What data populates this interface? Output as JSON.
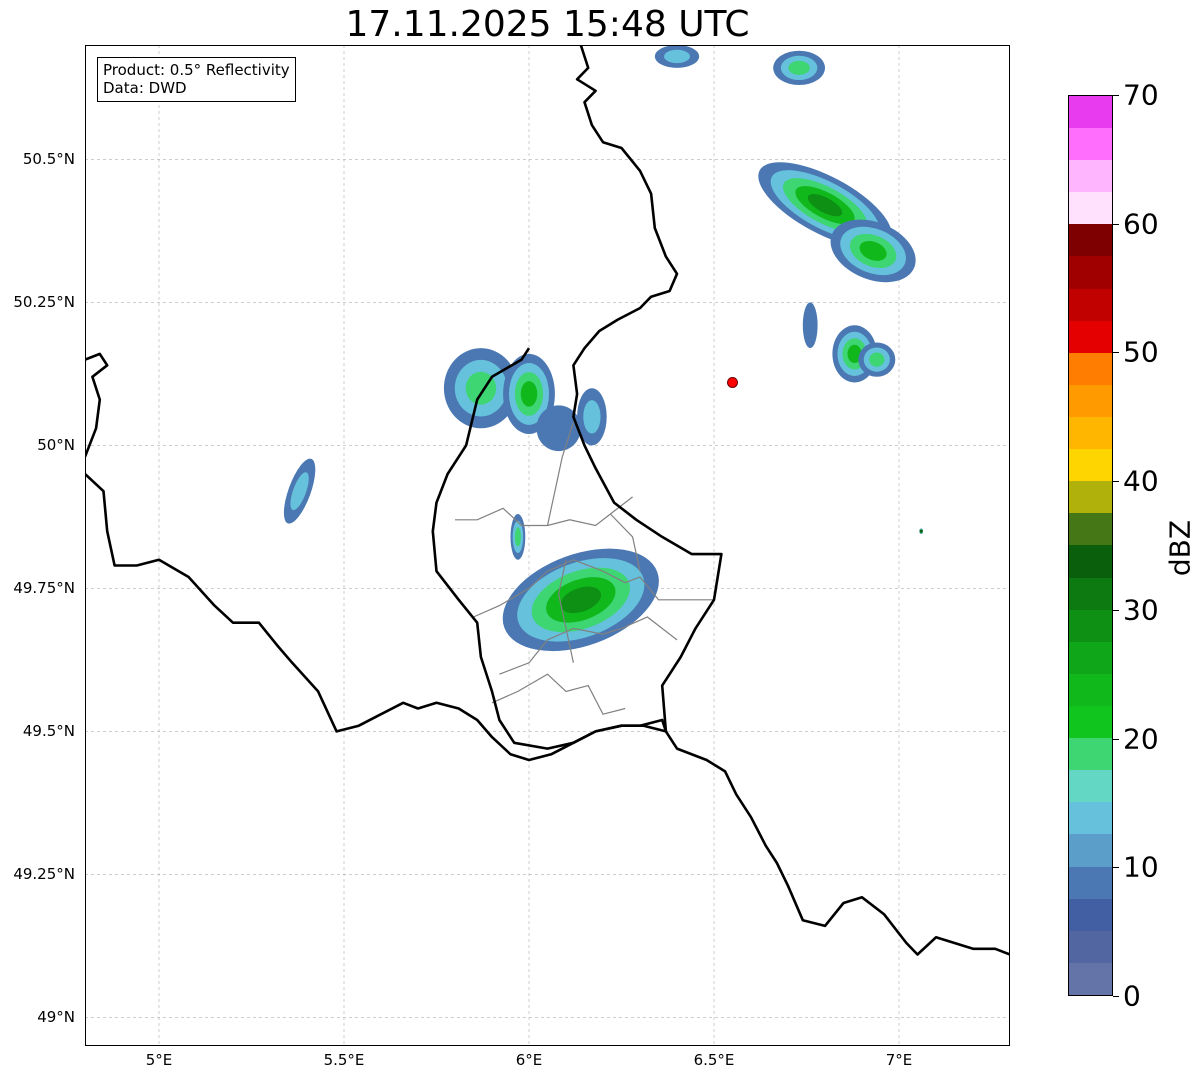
{
  "title": "17.11.2025 15:48 UTC",
  "info": {
    "product": "Product: 0.5° Reflectivity",
    "data": "Data: DWD"
  },
  "map": {
    "lon_range": [
      4.8,
      7.3
    ],
    "lat_range": [
      48.95,
      50.7
    ],
    "grid": true,
    "lon_ticks": [
      {
        "value": 5.0,
        "label": "5°E"
      },
      {
        "value": 5.5,
        "label": "5.5°E"
      },
      {
        "value": 6.0,
        "label": "6°E"
      },
      {
        "value": 6.5,
        "label": "6.5°E"
      },
      {
        "value": 7.0,
        "label": "7°E"
      }
    ],
    "lat_ticks": [
      {
        "value": 50.5,
        "label": "50.5°N"
      },
      {
        "value": 50.25,
        "label": "50.25°N"
      },
      {
        "value": 50.0,
        "label": "50°N"
      },
      {
        "value": 49.75,
        "label": "49.75°N"
      },
      {
        "value": 49.5,
        "label": "49.5°N"
      },
      {
        "value": 49.25,
        "label": "49.25°N"
      },
      {
        "value": 49.0,
        "label": "49°N"
      }
    ],
    "radar_site": {
      "lon": 6.55,
      "lat": 50.11,
      "color": "#ff0000"
    },
    "country_borders": [
      [
        [
          6.14,
          50.7
        ],
        [
          6.16,
          50.66
        ],
        [
          6.13,
          50.64
        ],
        [
          6.18,
          50.62
        ],
        [
          6.15,
          50.6
        ],
        [
          6.17,
          50.56
        ],
        [
          6.2,
          50.53
        ],
        [
          6.25,
          50.52
        ],
        [
          6.3,
          50.48
        ],
        [
          6.33,
          50.44
        ],
        [
          6.34,
          50.38
        ],
        [
          6.37,
          50.33
        ],
        [
          6.4,
          50.3
        ],
        [
          6.38,
          50.27
        ],
        [
          6.33,
          50.26
        ],
        [
          6.3,
          50.24
        ],
        [
          6.24,
          50.22
        ],
        [
          6.19,
          50.2
        ],
        [
          6.15,
          50.17
        ],
        [
          6.12,
          50.14
        ],
        [
          6.13,
          50.09
        ],
        [
          6.12,
          50.05
        ],
        [
          6.15,
          50.0
        ],
        [
          6.18,
          49.96
        ],
        [
          6.23,
          49.9
        ],
        [
          6.29,
          49.87
        ],
        [
          6.36,
          49.84
        ],
        [
          6.44,
          49.81
        ],
        [
          6.52,
          49.81
        ],
        [
          6.51,
          49.77
        ],
        [
          6.5,
          49.73
        ],
        [
          6.45,
          49.68
        ],
        [
          6.41,
          49.63
        ],
        [
          6.36,
          49.58
        ],
        [
          6.37,
          49.5
        ]
      ],
      [
        [
          6.37,
          49.5
        ],
        [
          6.36,
          49.52
        ],
        [
          6.3,
          49.51
        ],
        [
          6.25,
          49.51
        ],
        [
          6.18,
          49.5
        ],
        [
          6.12,
          49.48
        ],
        [
          6.06,
          49.46
        ],
        [
          6.0,
          49.45
        ],
        [
          5.95,
          49.46
        ],
        [
          5.9,
          49.49
        ],
        [
          5.86,
          49.52
        ],
        [
          5.81,
          49.54
        ],
        [
          5.75,
          49.55
        ],
        [
          5.7,
          49.54
        ],
        [
          5.66,
          49.55
        ],
        [
          5.6,
          49.53
        ],
        [
          5.54,
          49.51
        ],
        [
          5.48,
          49.5
        ],
        [
          5.43,
          49.57
        ],
        [
          5.36,
          49.62
        ],
        [
          5.32,
          49.65
        ],
        [
          5.27,
          49.69
        ],
        [
          5.2,
          49.69
        ],
        [
          5.15,
          49.72
        ],
        [
          5.08,
          49.77
        ],
        [
          5.0,
          49.8
        ],
        [
          4.94,
          49.79
        ],
        [
          4.88,
          49.79
        ],
        [
          4.86,
          49.85
        ],
        [
          4.85,
          49.92
        ],
        [
          4.8,
          49.95
        ]
      ],
      [
        [
          4.8,
          49.98
        ],
        [
          4.83,
          50.03
        ],
        [
          4.84,
          50.08
        ],
        [
          4.82,
          50.12
        ],
        [
          4.86,
          50.14
        ],
        [
          4.84,
          50.16
        ],
        [
          4.8,
          50.15
        ]
      ],
      [
        [
          6.37,
          49.5
        ],
        [
          6.4,
          49.47
        ],
        [
          6.48,
          49.45
        ],
        [
          6.53,
          49.43
        ],
        [
          6.56,
          49.39
        ],
        [
          6.6,
          49.35
        ],
        [
          6.64,
          49.3
        ],
        [
          6.67,
          49.27
        ],
        [
          6.7,
          49.23
        ],
        [
          6.74,
          49.17
        ],
        [
          6.8,
          49.16
        ],
        [
          6.85,
          49.2
        ],
        [
          6.9,
          49.21
        ],
        [
          6.96,
          49.18
        ],
        [
          7.02,
          49.13
        ],
        [
          7.05,
          49.11
        ],
        [
          7.1,
          49.14
        ],
        [
          7.15,
          49.13
        ],
        [
          7.2,
          49.12
        ],
        [
          7.26,
          49.12
        ],
        [
          7.3,
          49.11
        ]
      ],
      [
        [
          6.0,
          50.17
        ],
        [
          5.98,
          50.15
        ],
        [
          5.9,
          50.12
        ],
        [
          5.86,
          50.08
        ],
        [
          5.83,
          50.0
        ],
        [
          5.78,
          49.95
        ],
        [
          5.75,
          49.9
        ],
        [
          5.74,
          49.85
        ],
        [
          5.75,
          49.78
        ],
        [
          5.81,
          49.73
        ],
        [
          5.86,
          49.69
        ],
        [
          5.87,
          49.63
        ],
        [
          5.9,
          49.57
        ],
        [
          5.92,
          49.52
        ],
        [
          5.96,
          49.48
        ],
        [
          6.05,
          49.47
        ],
        [
          6.12,
          49.48
        ],
        [
          6.18,
          49.5
        ],
        [
          6.25,
          49.51
        ],
        [
          6.31,
          49.51
        ],
        [
          6.37,
          49.5
        ]
      ]
    ],
    "inner_borders": [
      [
        [
          5.8,
          49.87
        ],
        [
          5.86,
          49.87
        ],
        [
          5.93,
          49.89
        ],
        [
          5.98,
          49.86
        ],
        [
          6.05,
          49.86
        ],
        [
          6.11,
          49.87
        ],
        [
          6.18,
          49.86
        ],
        [
          6.22,
          49.88
        ],
        [
          6.28,
          49.91
        ]
      ],
      [
        [
          5.85,
          49.7
        ],
        [
          5.92,
          49.72
        ],
        [
          6.0,
          49.75
        ],
        [
          6.05,
          49.78
        ],
        [
          6.12,
          49.8
        ],
        [
          6.2,
          49.78
        ],
        [
          6.26,
          49.76
        ],
        [
          6.3,
          49.77
        ],
        [
          6.35,
          49.73
        ],
        [
          6.45,
          49.73
        ],
        [
          6.5,
          49.73
        ]
      ],
      [
        [
          5.92,
          49.6
        ],
        [
          6.0,
          49.62
        ],
        [
          6.05,
          49.66
        ],
        [
          6.12,
          49.68
        ],
        [
          6.2,
          49.67
        ],
        [
          6.25,
          49.68
        ],
        [
          6.32,
          49.7
        ],
        [
          6.4,
          49.66
        ]
      ],
      [
        [
          5.9,
          49.55
        ],
        [
          5.97,
          49.57
        ],
        [
          6.05,
          49.6
        ],
        [
          6.1,
          49.57
        ],
        [
          6.16,
          49.58
        ],
        [
          6.2,
          49.53
        ],
        [
          6.26,
          49.54
        ]
      ],
      [
        [
          6.05,
          49.86
        ],
        [
          6.07,
          49.92
        ],
        [
          6.09,
          49.98
        ],
        [
          6.12,
          50.04
        ]
      ],
      [
        [
          6.1,
          49.8
        ],
        [
          6.08,
          49.74
        ],
        [
          6.1,
          49.68
        ],
        [
          6.12,
          49.62
        ]
      ],
      [
        [
          6.22,
          49.88
        ],
        [
          6.28,
          49.84
        ],
        [
          6.3,
          49.78
        ]
      ]
    ],
    "echo_cells": [
      {
        "lon": 5.87,
        "lat": 50.1,
        "rlon": 0.1,
        "rlat": 0.07,
        "rot": 0,
        "peak": 22
      },
      {
        "lon": 6.0,
        "lat": 50.09,
        "rlon": 0.07,
        "rlat": 0.07,
        "rot": 0,
        "peak": 24
      },
      {
        "lon": 6.08,
        "lat": 50.03,
        "rlon": 0.06,
        "rlat": 0.04,
        "rot": 0,
        "peak": 12
      },
      {
        "lon": 6.17,
        "lat": 50.05,
        "rlon": 0.04,
        "rlat": 0.05,
        "rot": 0,
        "peak": 13
      },
      {
        "lon": 5.38,
        "lat": 49.92,
        "rlon": 0.03,
        "rlat": 0.06,
        "rot": 20,
        "peak": 13
      },
      {
        "lon": 6.14,
        "lat": 49.73,
        "rlon": 0.22,
        "rlat": 0.08,
        "rot": -20,
        "peak": 30
      },
      {
        "lon": 5.97,
        "lat": 49.84,
        "rlon": 0.02,
        "rlat": 0.04,
        "rot": 0,
        "peak": 18
      },
      {
        "lon": 6.8,
        "lat": 50.42,
        "rlon": 0.2,
        "rlat": 0.05,
        "rot": 28,
        "peak": 30
      },
      {
        "lon": 6.93,
        "lat": 50.34,
        "rlon": 0.12,
        "rlat": 0.05,
        "rot": 22,
        "peak": 26
      },
      {
        "lon": 6.88,
        "lat": 50.16,
        "rlon": 0.06,
        "rlat": 0.05,
        "rot": 0,
        "peak": 24
      },
      {
        "lon": 6.94,
        "lat": 50.15,
        "rlon": 0.05,
        "rlat": 0.03,
        "rot": 0,
        "peak": 22
      },
      {
        "lon": 6.73,
        "lat": 50.66,
        "rlon": 0.07,
        "rlat": 0.03,
        "rot": 0,
        "peak": 18
      },
      {
        "lon": 6.4,
        "lat": 50.68,
        "rlon": 0.06,
        "rlat": 0.02,
        "rot": 0,
        "peak": 16
      },
      {
        "lon": 6.76,
        "lat": 50.21,
        "rlon": 0.02,
        "rlat": 0.04,
        "rot": 0,
        "peak": 10
      },
      {
        "lon": 7.06,
        "lat": 49.85,
        "rlon": 0.005,
        "rlat": 0.005,
        "rot": 0,
        "peak": 35
      }
    ]
  },
  "colorbar": {
    "label": "dBZ",
    "vmin": 0,
    "vmax": 70,
    "step": 2.5,
    "tick_values": [
      "0",
      "10",
      "20",
      "30",
      "40",
      "50",
      "60",
      "70"
    ],
    "colors": [
      "#6473a8",
      "#5266a2",
      "#435fa3",
      "#4b78b2",
      "#5a9ec9",
      "#66c1dc",
      "#64d6c4",
      "#3ed672",
      "#11c51f",
      "#10b81c",
      "#10a61a",
      "#0d9014",
      "#0c7a11",
      "#0a5f0d",
      "#467716",
      "#b0b10a",
      "#fed500",
      "#ffb600",
      "#ff9b00",
      "#ff7d00",
      "#e40000",
      "#c10000",
      "#a00000",
      "#7f0000",
      "#ffe0fd",
      "#feb5fe",
      "#ff6efd",
      "#e83aee"
    ]
  }
}
